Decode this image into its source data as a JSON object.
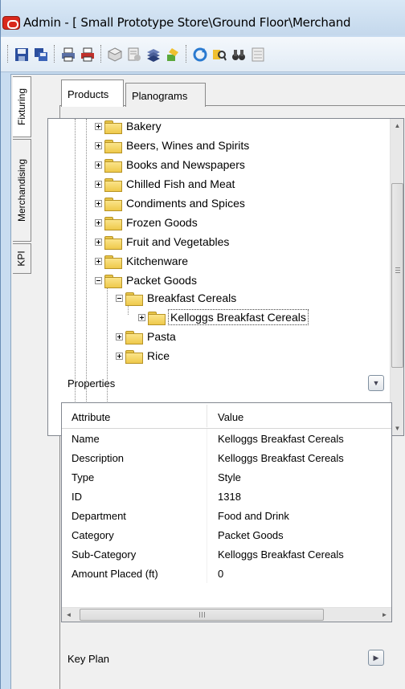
{
  "window": {
    "title": "Admin - [ Small Prototype Store\\Ground Floor\\Merchand"
  },
  "toolbar": {
    "icons": [
      "save-icon",
      "multi-save-icon",
      "print-icon",
      "print-preview-icon",
      "cube-icon",
      "properties-icon",
      "layers-icon",
      "paint-icon",
      "refresh-icon",
      "find-icon",
      "binoculars-icon",
      "list-icon"
    ]
  },
  "side_tabs": [
    {
      "label": "Fixturing"
    },
    {
      "label": "Merchandising"
    },
    {
      "label": "KPI"
    }
  ],
  "tabs": [
    {
      "label": "Products"
    },
    {
      "label": "Planograms"
    }
  ],
  "tree": {
    "items": [
      {
        "label": "Bakery"
      },
      {
        "label": "Beers, Wines and Spirits"
      },
      {
        "label": "Books and Newspapers"
      },
      {
        "label": "Chilled Fish and Meat"
      },
      {
        "label": "Condiments and Spices"
      },
      {
        "label": "Frozen Goods"
      },
      {
        "label": "Fruit and Vegetables"
      },
      {
        "label": "Kitchenware"
      },
      {
        "label": "Packet Goods"
      },
      {
        "label": "Breakfast Cereals"
      },
      {
        "label": "Kelloggs Breakfast Cereals"
      },
      {
        "label": "Pasta"
      },
      {
        "label": "Rice"
      }
    ],
    "scroll_up_glyph": "▲",
    "scroll_down_glyph": "▼"
  },
  "properties": {
    "title": "Properties",
    "columns": {
      "attribute": "Attribute",
      "value": "Value"
    },
    "rows": [
      {
        "attribute": "Name",
        "value": "Kelloggs Breakfast Cereals"
      },
      {
        "attribute": "Description",
        "value": "Kelloggs Breakfast Cereals"
      },
      {
        "attribute": "Type",
        "value": "Style"
      },
      {
        "attribute": "ID",
        "value": "1318"
      },
      {
        "attribute": "Department",
        "value": "Food and Drink"
      },
      {
        "attribute": "Category",
        "value": "Packet Goods"
      },
      {
        "attribute": "Sub-Category",
        "value": "Kelloggs Breakfast Cereals"
      },
      {
        "attribute": "Amount Placed (ft)",
        "value": "0"
      }
    ],
    "hscroll_left_glyph": "◄",
    "hscroll_right_glyph": "►"
  },
  "key_plan": {
    "title": "Key Plan"
  }
}
